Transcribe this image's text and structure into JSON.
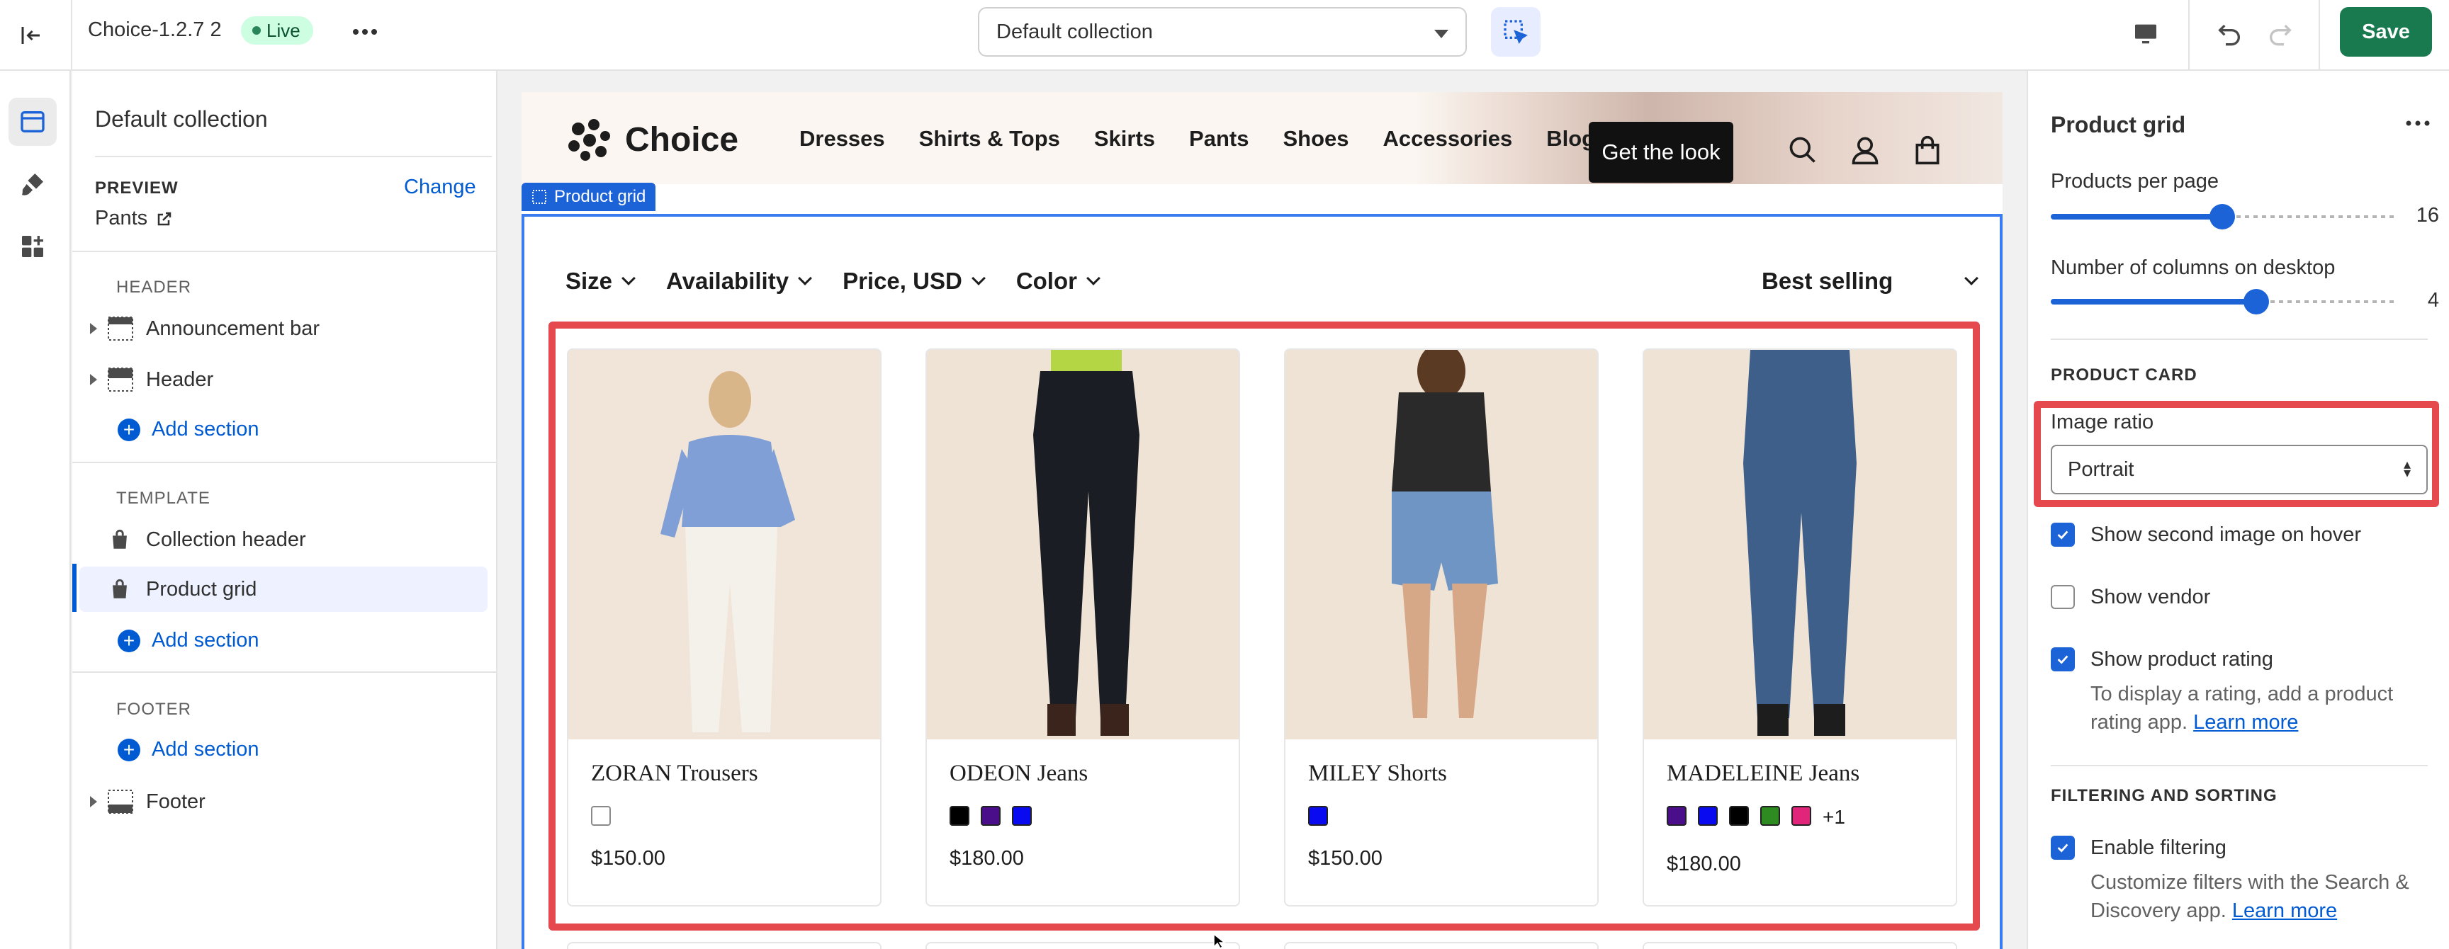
{
  "topbar": {
    "theme_name": "Choice-1.2.7 2",
    "status_badge": "Live",
    "template_select": "Default collection",
    "save_label": "Save"
  },
  "left_panel": {
    "title": "Default collection",
    "preview_label": "PREVIEW",
    "change_label": "Change",
    "preview_value": "Pants",
    "groups": {
      "header": {
        "label": "HEADER",
        "items": [
          "Announcement bar",
          "Header"
        ],
        "add_label": "Add section"
      },
      "template": {
        "label": "TEMPLATE",
        "items": [
          "Collection header",
          "Product grid"
        ],
        "add_label": "Add section"
      },
      "footer": {
        "label": "FOOTER",
        "add_label": "Add section",
        "items": [
          "Footer"
        ]
      }
    }
  },
  "storefront": {
    "logo": "Choice",
    "nav": [
      "Dresses",
      "Shirts & Tops",
      "Skirts",
      "Pants",
      "Shoes",
      "Accessories",
      "Blog"
    ],
    "cta": "Get the look",
    "section_tag": "Product grid",
    "filters": [
      "Size",
      "Availability",
      "Price, USD",
      "Color"
    ],
    "sort": "Best selling",
    "products": [
      {
        "title": "ZORAN Trousers",
        "price": "$150.00",
        "swatches": [
          "#ffffff"
        ],
        "more": ""
      },
      {
        "title": "ODEON Jeans",
        "price": "$180.00",
        "swatches": [
          "#000000",
          "#4b0e8a",
          "#0a0af0"
        ],
        "more": ""
      },
      {
        "title": "MILEY Shorts",
        "price": "$150.00",
        "swatches": [
          "#0a0af0"
        ],
        "more": ""
      },
      {
        "title": "MADELEINE Jeans",
        "price": "$180.00",
        "swatches": [
          "#4b0e8a",
          "#0a0af0",
          "#000000",
          "#2e8b22",
          "#e0257a"
        ],
        "more": "+1"
      }
    ]
  },
  "right_panel": {
    "title": "Product grid",
    "products_per_page_label": "Products per page",
    "products_per_page": "16",
    "products_per_page_fraction": 0.5,
    "columns_label": "Number of columns on desktop",
    "columns": "4",
    "columns_fraction": 0.6,
    "product_card_section": "PRODUCT CARD",
    "image_ratio_label": "Image ratio",
    "image_ratio": "Portrait",
    "show_second_image": "Show second image on hover",
    "show_vendor": "Show vendor",
    "show_rating": "Show product rating",
    "rating_help": "To display a rating, add a product rating app.",
    "learn_more": "Learn more",
    "filtering_section": "FILTERING AND SORTING",
    "enable_filtering": "Enable filtering",
    "filtering_help": "Customize filters with the Search & Discovery app.",
    "learn_more_2": "Learn more"
  },
  "colors": {
    "accent": "#1d63d8",
    "save": "#1a7a4f",
    "highlight": "#e5484d"
  }
}
